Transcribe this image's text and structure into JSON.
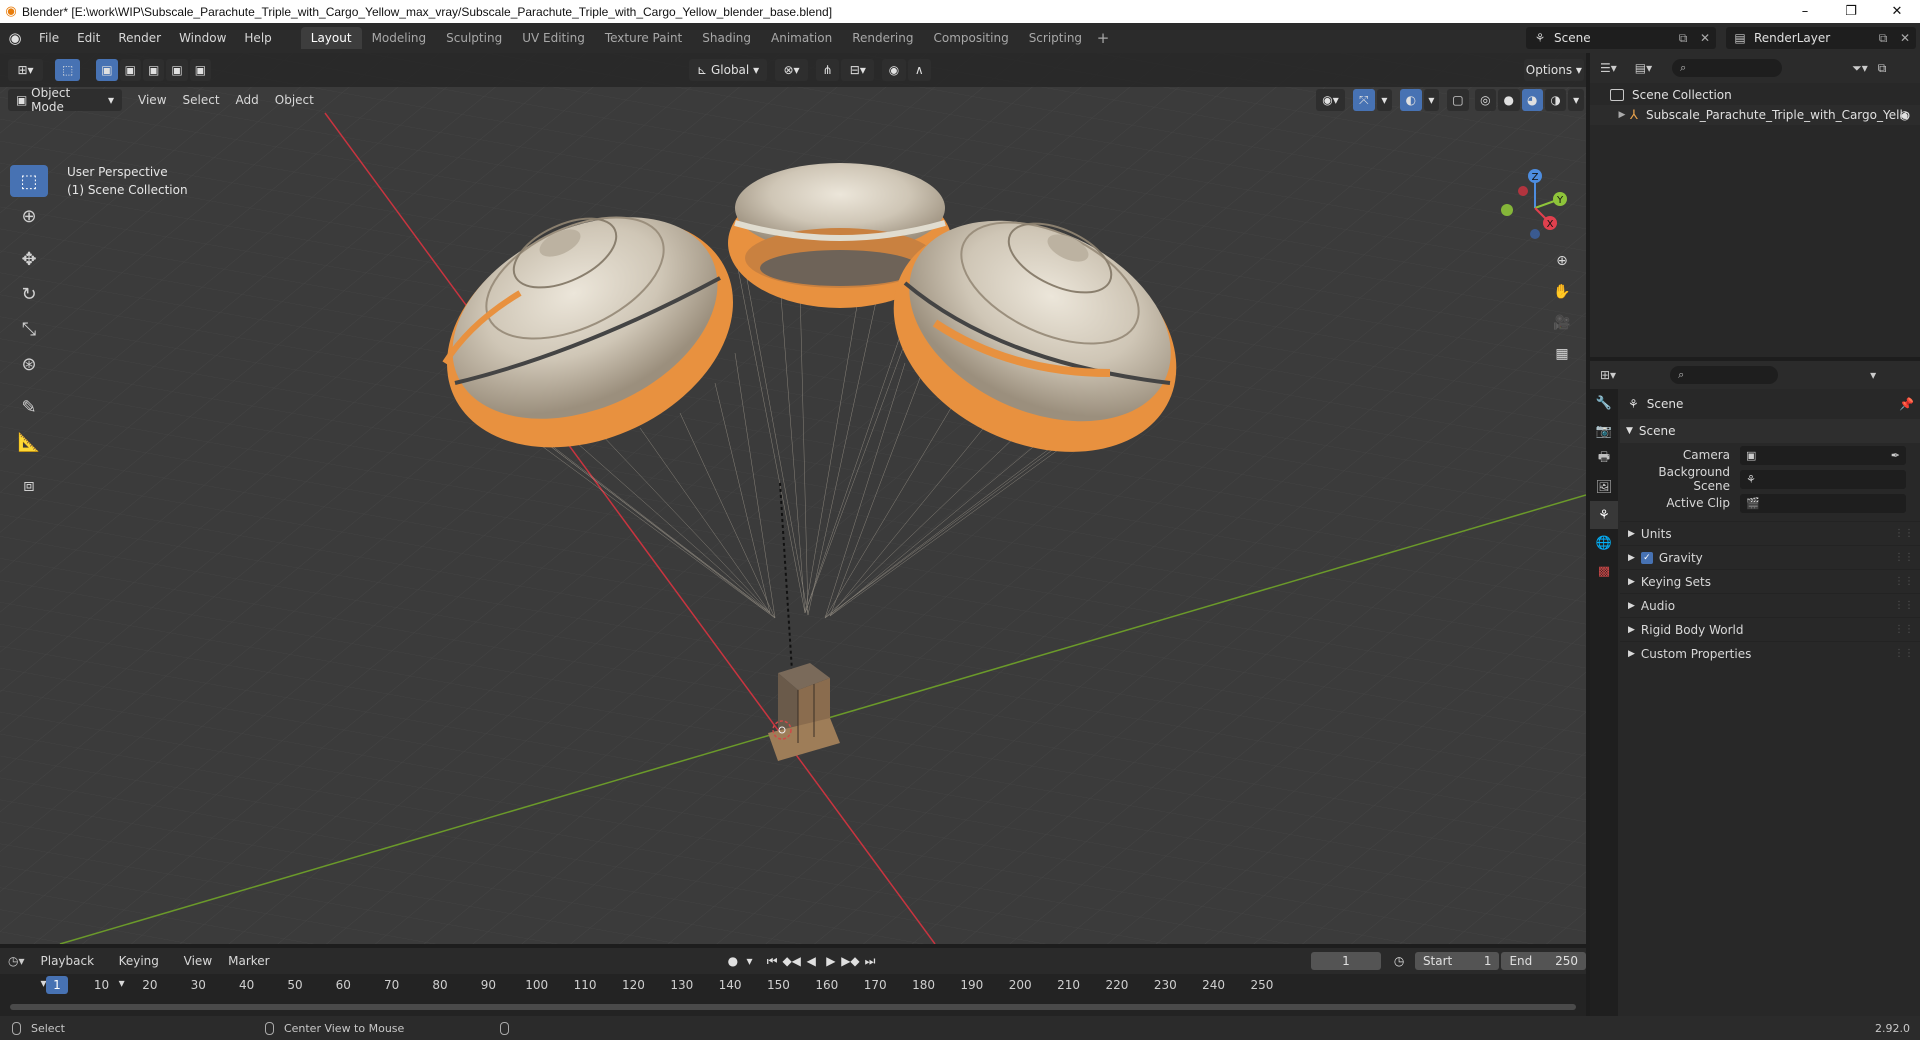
{
  "window": {
    "title": "Blender* [E:\\work\\WIP\\Subscale_Parachute_Triple_with_Cargo_Yellow_max_vray/Subscale_Parachute_Triple_with_Cargo_Yellow_blender_base.blend]",
    "controls": [
      "–",
      "❐",
      "✕"
    ]
  },
  "menu": {
    "items": [
      "File",
      "Edit",
      "Render",
      "Window",
      "Help"
    ]
  },
  "workspaces": {
    "tabs": [
      "Layout",
      "Modeling",
      "Sculpting",
      "UV Editing",
      "Texture Paint",
      "Shading",
      "Animation",
      "Rendering",
      "Compositing",
      "Scripting"
    ],
    "active": "Layout",
    "add": "+"
  },
  "scene_selector": {
    "value": "Scene"
  },
  "view_layer": {
    "value": "RenderLayer"
  },
  "viewport": {
    "mode": "Object Mode",
    "menus": [
      "View",
      "Select",
      "Add",
      "Object"
    ],
    "transform_orientation": "Global",
    "options_label": "Options",
    "overlay_line1": "User Perspective",
    "overlay_line2": "(1) Scene Collection",
    "colors": {
      "background": "#3b3b3b",
      "x_axis": "#c8343f",
      "y_axis": "#6b9a2a",
      "canopy_orange": "#e8913f",
      "canopy_white": "#d9d2c4"
    }
  },
  "gizmo": {
    "x": "X",
    "y": "Y",
    "z": "Z"
  },
  "tools": [
    "select-box",
    "cursor",
    "move",
    "rotate",
    "scale",
    "transform",
    "annotate",
    "measure",
    "add-cube"
  ],
  "outliner": {
    "search_placeholder": "",
    "root": "Scene Collection",
    "object": "Subscale_Parachute_Triple_with_Cargo_Yello"
  },
  "properties": {
    "title": "Scene",
    "panel_scene": "Scene",
    "camera_label": "Camera",
    "background_scene_label": "Background Scene",
    "active_clip_label": "Active Clip",
    "subpanels": {
      "units": "Units",
      "gravity": "Gravity",
      "keying_sets": "Keying Sets",
      "audio": "Audio",
      "rigid_body_world": "Rigid Body World",
      "custom_properties": "Custom Properties"
    }
  },
  "timeline": {
    "menus": [
      "Playback",
      "Keying",
      "View",
      "Marker"
    ],
    "current_frame": "1",
    "start_label": "Start",
    "start": "1",
    "end_label": "End",
    "end": "250",
    "ticks": [
      "10",
      "20",
      "30",
      "40",
      "50",
      "60",
      "70",
      "80",
      "90",
      "100",
      "110",
      "120",
      "130",
      "140",
      "150",
      "160",
      "170",
      "180",
      "190",
      "200",
      "210",
      "220",
      "230",
      "240",
      "250"
    ]
  },
  "status": {
    "select": "Select",
    "center_view": "Center View to Mouse",
    "version": "2.92.0"
  }
}
